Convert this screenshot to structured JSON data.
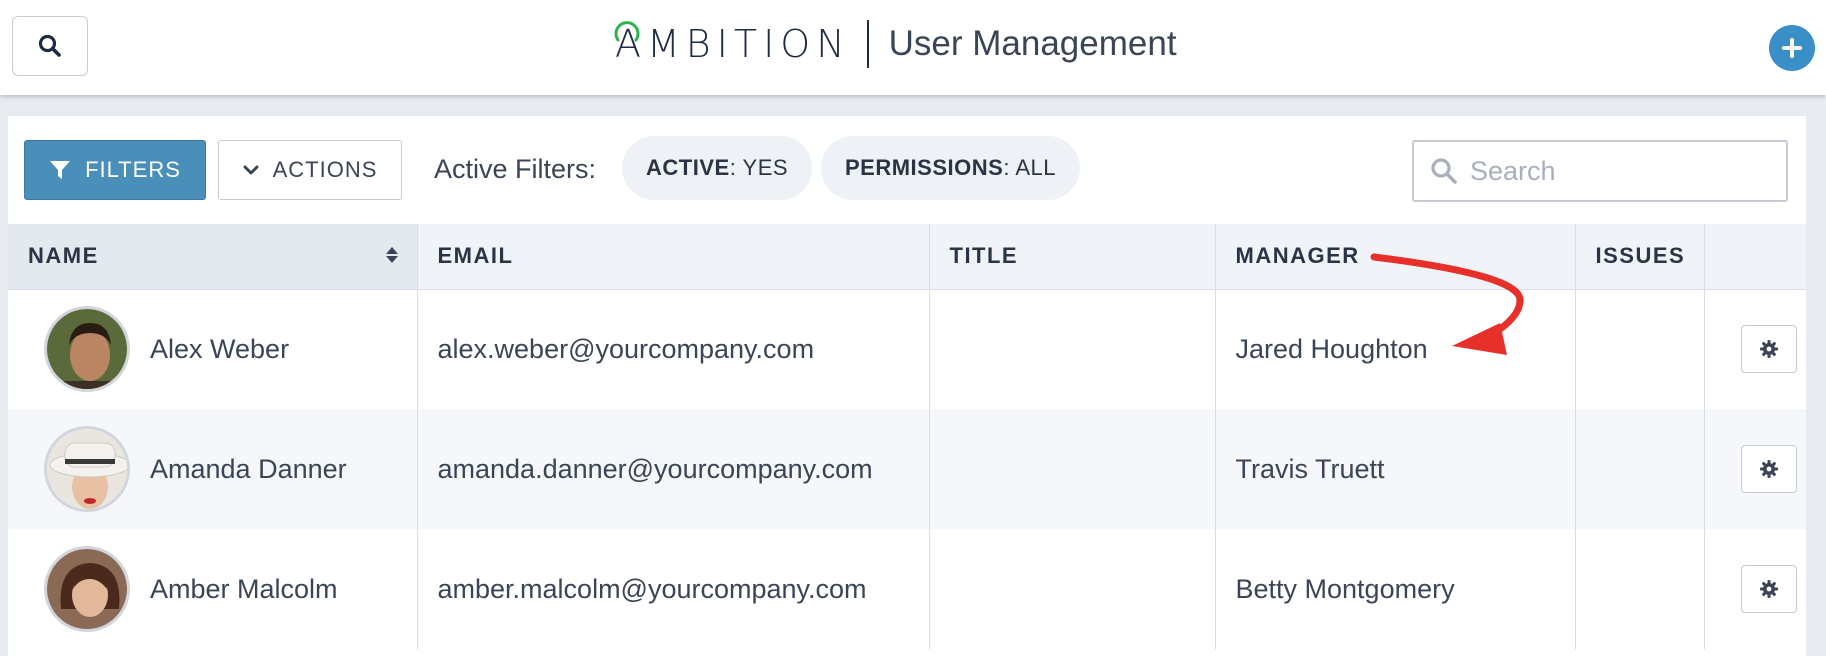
{
  "header": {
    "logo_text": "AMBITION",
    "title": "User Management",
    "add_icon": "plus-icon",
    "search_icon": "search-icon"
  },
  "toolbar": {
    "filters_label": "FILTERS",
    "actions_label": "ACTIONS",
    "active_filters_label": "Active Filters:",
    "chips": [
      {
        "key": "ACTIVE",
        "value": ": YES"
      },
      {
        "key": "PERMISSIONS",
        "value": ": ALL"
      }
    ],
    "search_placeholder": "Search"
  },
  "table": {
    "columns": [
      "NAME",
      "EMAIL",
      "TITLE",
      "MANAGER",
      "ISSUES",
      ""
    ],
    "rows": [
      {
        "name": "Alex Weber",
        "email": "alex.weber@yourcompany.com",
        "title": "",
        "manager": "Jared Houghton",
        "issues": ""
      },
      {
        "name": "Amanda Danner",
        "email": "amanda.danner@yourcompany.com",
        "title": "",
        "manager": "Travis Truett",
        "issues": ""
      },
      {
        "name": "Amber Malcolm",
        "email": "amber.malcolm@yourcompany.com",
        "title": "",
        "manager": "Betty Montgomery",
        "issues": ""
      }
    ]
  },
  "colors": {
    "accent": "#4a8fba",
    "add_button": "#3a8fc7",
    "annotation_arrow": "#e8302a",
    "logo_ring": "#2eb34a"
  }
}
